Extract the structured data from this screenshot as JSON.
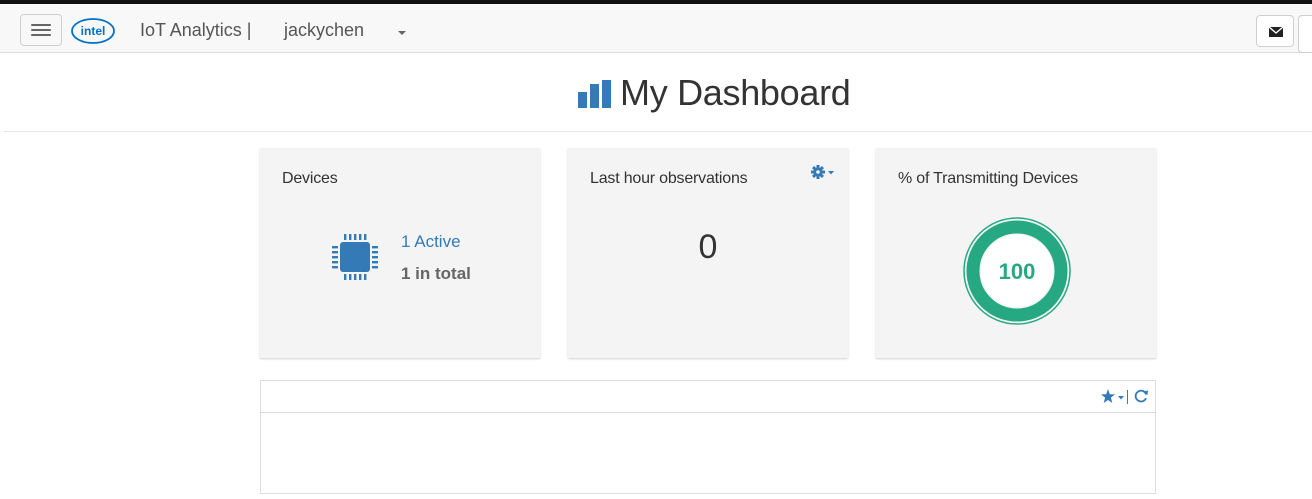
{
  "navbar": {
    "app_title": "IoT Analytics |",
    "user_name": "jackychen",
    "logo_text": "intel"
  },
  "page": {
    "title": "My Dashboard"
  },
  "cards": {
    "devices": {
      "title": "Devices",
      "active_label": "1 Active",
      "total_label": "1 in total"
    },
    "observations": {
      "title": "Last hour observations",
      "value": "0"
    },
    "transmitting": {
      "title": "% of Transmitting Devices",
      "value": "100"
    }
  },
  "icons": {
    "menu": "hamburger-icon",
    "mail": "envelope-icon",
    "title": "bar-chart-icon",
    "devices": "chip-icon",
    "settings": "gear-icon",
    "favorite": "star-icon",
    "refresh": "refresh-icon"
  },
  "colors": {
    "accent": "#337ab7",
    "success": "#26a982",
    "card_bg": "#f4f4f4"
  }
}
